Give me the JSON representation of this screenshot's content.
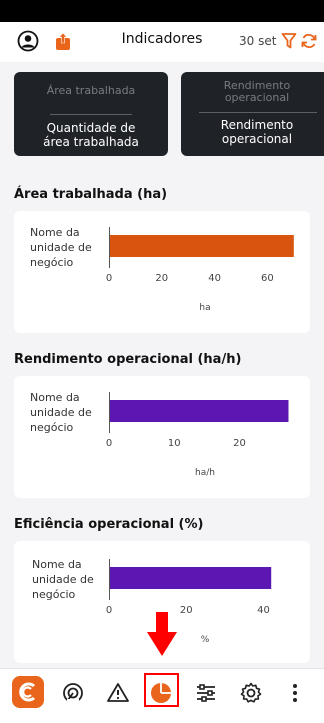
{
  "header": {
    "title": "Indicadores",
    "date": "30 set"
  },
  "kpi_cards": [
    {
      "subtitle": "Área trabalhada",
      "label_line1": "Quantidade de",
      "label_line2": "área trabalhada"
    },
    {
      "subtitle_line1": "Rendimento",
      "subtitle_line2": "operacional",
      "label_line1": "Rendimento",
      "label_line2": "operacional"
    }
  ],
  "sections": [
    {
      "title": "Área trabalhada (ha)",
      "unit_line1": "Nome da",
      "unit_line2": "unidade de",
      "unit_line3": "negócio",
      "axis_unit": "ha"
    },
    {
      "title": "Rendimento operacional (ha/h)",
      "unit_line1": "Nome da",
      "unit_line2": "unidade de",
      "unit_line3": "negócio",
      "axis_unit": "ha/h"
    },
    {
      "title": "Eficiência operacional (%)",
      "unit_line1": "Nome da",
      "unit_line2": "unidade de",
      "unit_line3": "negócio",
      "axis_unit": "%"
    }
  ],
  "chart_data": [
    {
      "type": "bar",
      "orientation": "horizontal",
      "title": "Área trabalhada (ha)",
      "categories": [
        "Nome da unidade de negócio"
      ],
      "values": [
        70
      ],
      "xlabel": "ha",
      "xticks": [
        0,
        20,
        40,
        60
      ],
      "xlim": [
        0,
        75
      ],
      "color": "#d9550f"
    },
    {
      "type": "bar",
      "orientation": "horizontal",
      "title": "Rendimento operacional (ha/h)",
      "categories": [
        "Nome da unidade de negócio"
      ],
      "values": [
        27.5
      ],
      "xlabel": "ha/h",
      "xticks": [
        0,
        10,
        20
      ],
      "xlim": [
        0,
        28.5
      ],
      "color": "#5c17b3"
    },
    {
      "type": "bar",
      "orientation": "horizontal",
      "title": "Eficiência operacional (%)",
      "categories": [
        "Nome da unidade de negócio"
      ],
      "values": [
        42
      ],
      "xlabel": "%",
      "xticks": [
        0,
        20,
        40
      ],
      "xlim": [
        0,
        58
      ],
      "color": "#5c17b3"
    }
  ],
  "colors": {
    "accent": "#e8651b",
    "dark_card": "#1f2227",
    "orange_bar": "#d9550f",
    "purple_bar": "#5c17b3",
    "annotation": "#ff0000"
  },
  "nav": [
    "logo",
    "gauge-icon",
    "warning-icon",
    "pie-chart-icon",
    "sliders-icon",
    "gear-icon",
    "more-vertical-icon"
  ]
}
